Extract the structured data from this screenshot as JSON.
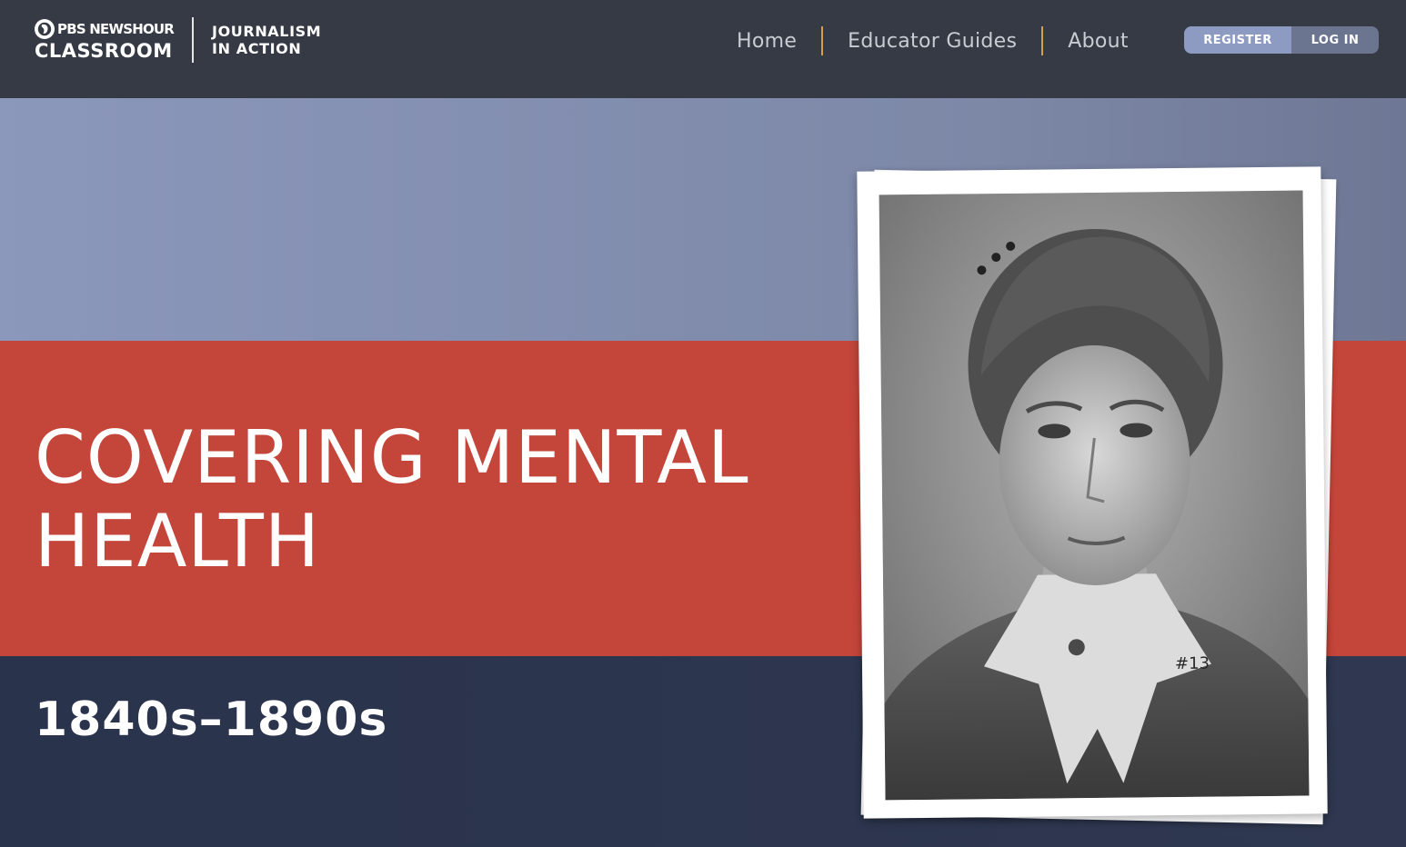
{
  "header": {
    "brand": {
      "network": "PBS NEWSHOUR",
      "product": "CLASSROOM",
      "series_line1": "JOURNALISM",
      "series_line2": "IN ACTION"
    },
    "nav": [
      {
        "label": "Home"
      },
      {
        "label": "Educator Guides"
      },
      {
        "label": "About"
      }
    ],
    "auth": {
      "register_label": "REGISTER",
      "login_label": "LOG IN"
    }
  },
  "hero": {
    "title": "COVERING MENTAL HEALTH",
    "era": "1840s–1890s",
    "photo": {
      "icon": "portrait-photo",
      "annotation": "#13"
    }
  },
  "colors": {
    "topbar": "#353a44",
    "nav_separator": "#d6a04a",
    "band_top": "#8b97bb",
    "band_red": "#c4453a",
    "band_bottom": "#2a334c",
    "register": "#8d9bc3",
    "login": "#6b7590"
  }
}
